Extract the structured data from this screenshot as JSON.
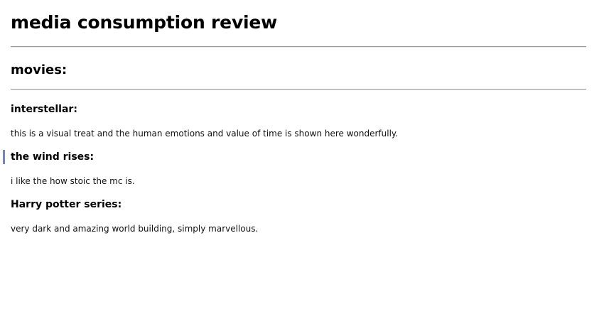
{
  "page": {
    "title": "media consumption review"
  },
  "section": {
    "title": "movies:"
  },
  "reviews": [
    {
      "title": "interstellar:",
      "text": "this is a visual treat and the human emotions and value of time is shown here wonderfully."
    },
    {
      "title": "the wind rises:",
      "text": "i like the how stoic the mc is."
    },
    {
      "title": "Harry potter series:",
      "text": "very dark and amazing world building, simply marvellous."
    }
  ],
  "colors": {
    "rule": "#9a9a9a",
    "focus_marker": "#7b86a8"
  }
}
